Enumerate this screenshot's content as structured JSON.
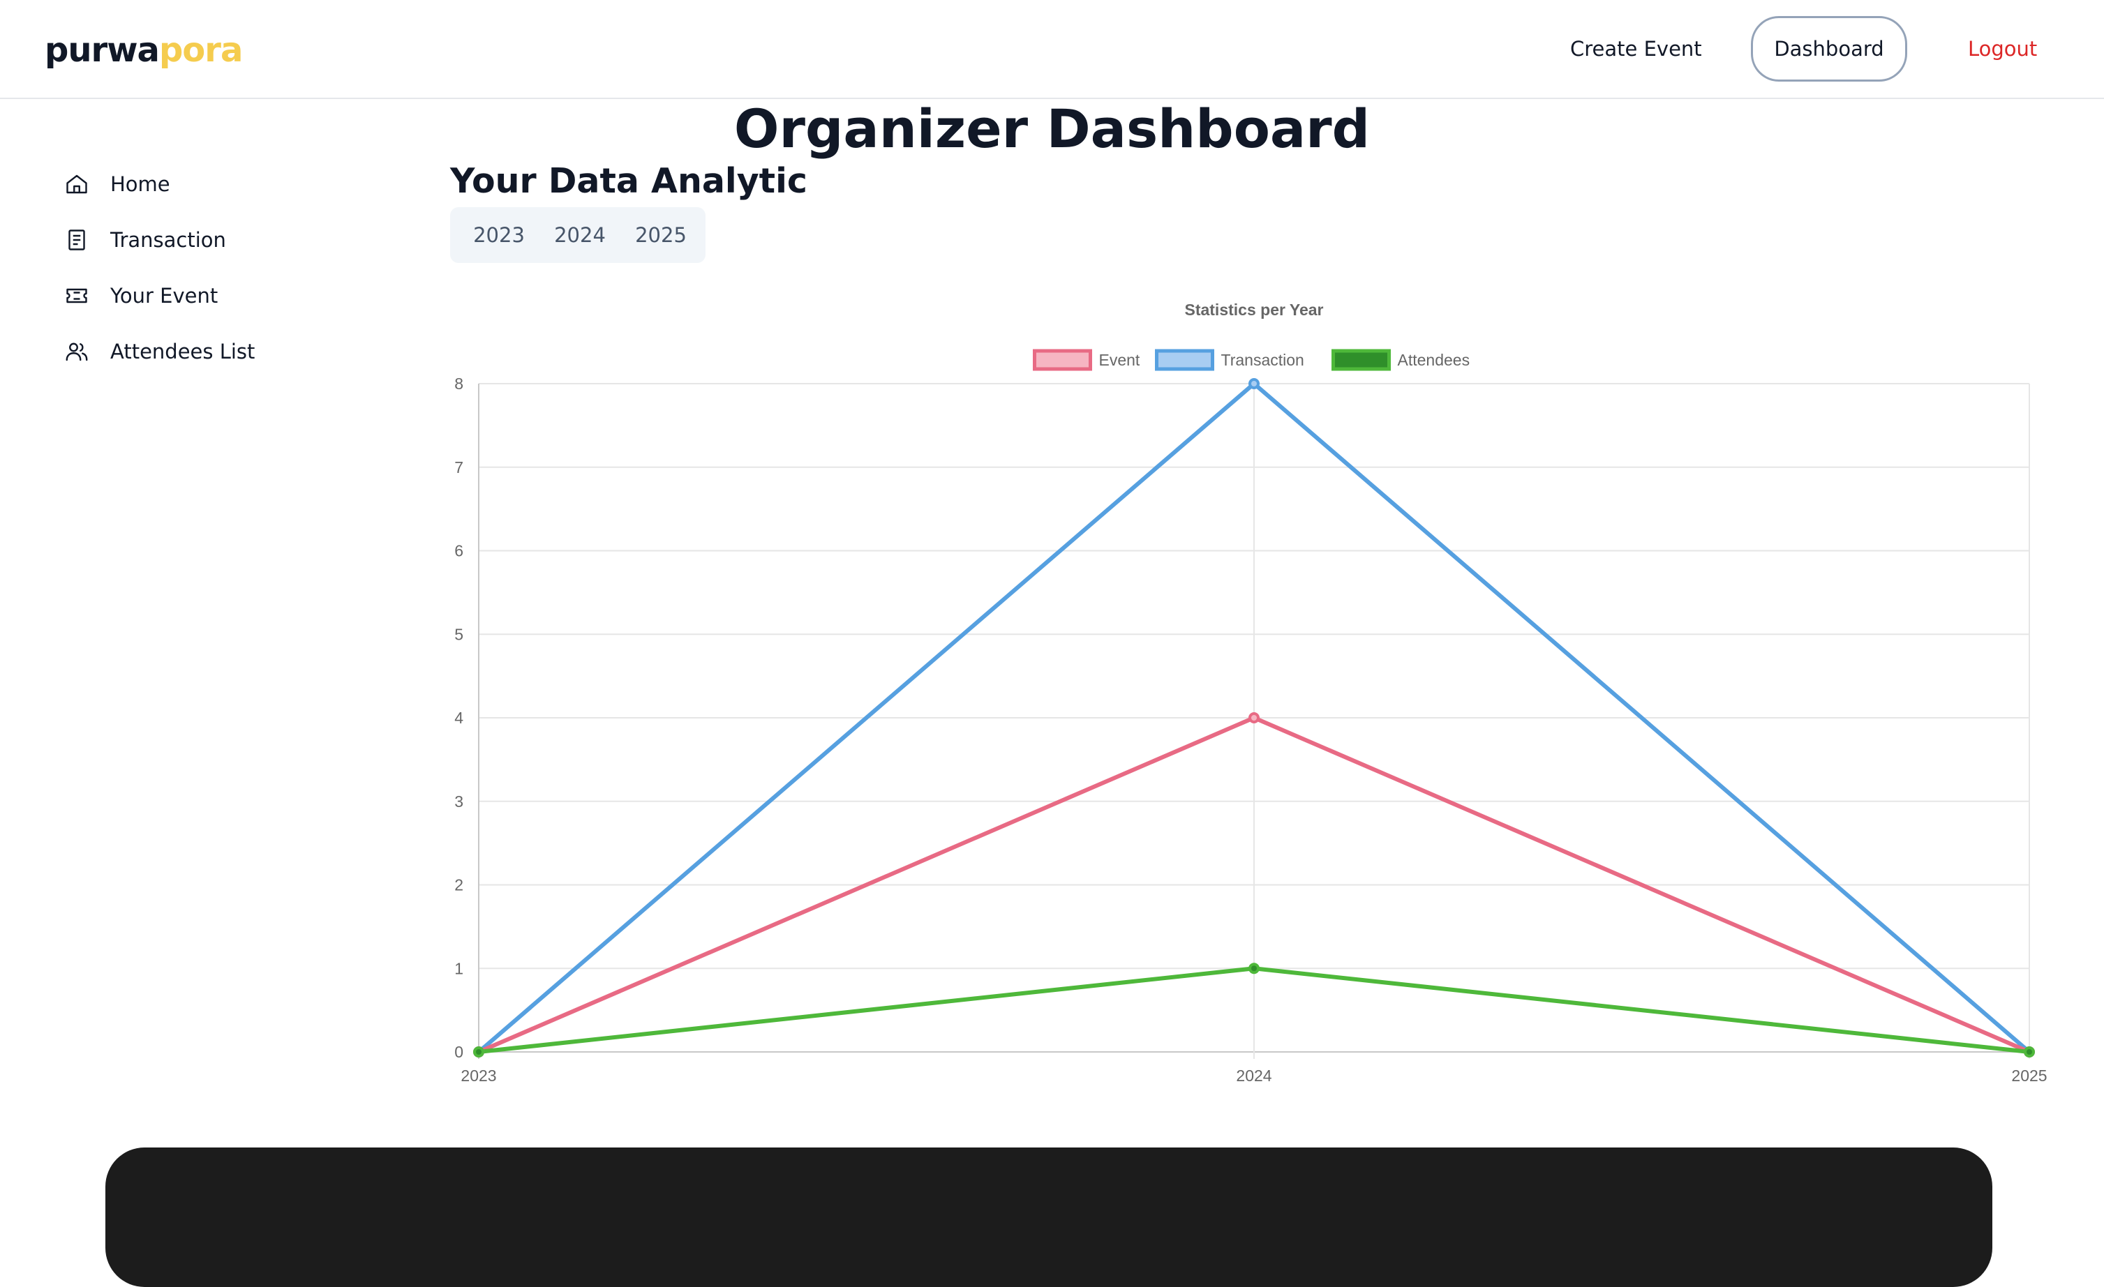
{
  "brand": {
    "part1": "purwa",
    "part2": "pora"
  },
  "nav": {
    "create_event": "Create Event",
    "dashboard": "Dashboard",
    "logout": "Logout"
  },
  "sidebar": {
    "items": [
      {
        "label": "Home",
        "icon": "home-icon"
      },
      {
        "label": "Transaction",
        "icon": "receipt-icon"
      },
      {
        "label": "Your Event",
        "icon": "ticket-icon"
      },
      {
        "label": "Attendees List",
        "icon": "users-icon"
      }
    ]
  },
  "main": {
    "title": "Organizer Dashboard",
    "section_title": "Your Data Analytic",
    "year_tabs": [
      "2023",
      "2024",
      "2025"
    ]
  },
  "colors": {
    "accent_brand": "#f5cc4e",
    "logout": "#dc2626",
    "event": "#e86a84",
    "transaction": "#56a0e0",
    "attendees": "#4eb83a"
  },
  "chart_data": {
    "type": "line",
    "title": "Statistics per Year",
    "x": [
      "2023",
      "2024",
      "2025"
    ],
    "ylim": [
      0,
      8
    ],
    "yticks": [
      "0",
      "1",
      "2",
      "3",
      "4",
      "5",
      "6",
      "7",
      "8"
    ],
    "grid": true,
    "legend_position": "top",
    "series": [
      {
        "name": "Event",
        "values": [
          0,
          4,
          0
        ],
        "color": "#e86a84",
        "fill": "#f6b5c2"
      },
      {
        "name": "Transaction",
        "values": [
          0,
          8,
          0
        ],
        "color": "#56a0e0",
        "fill": "#a8cdf2"
      },
      {
        "name": "Attendees",
        "values": [
          0,
          1,
          0
        ],
        "color": "#4eb83a",
        "fill": "#2f8f2a"
      }
    ]
  }
}
